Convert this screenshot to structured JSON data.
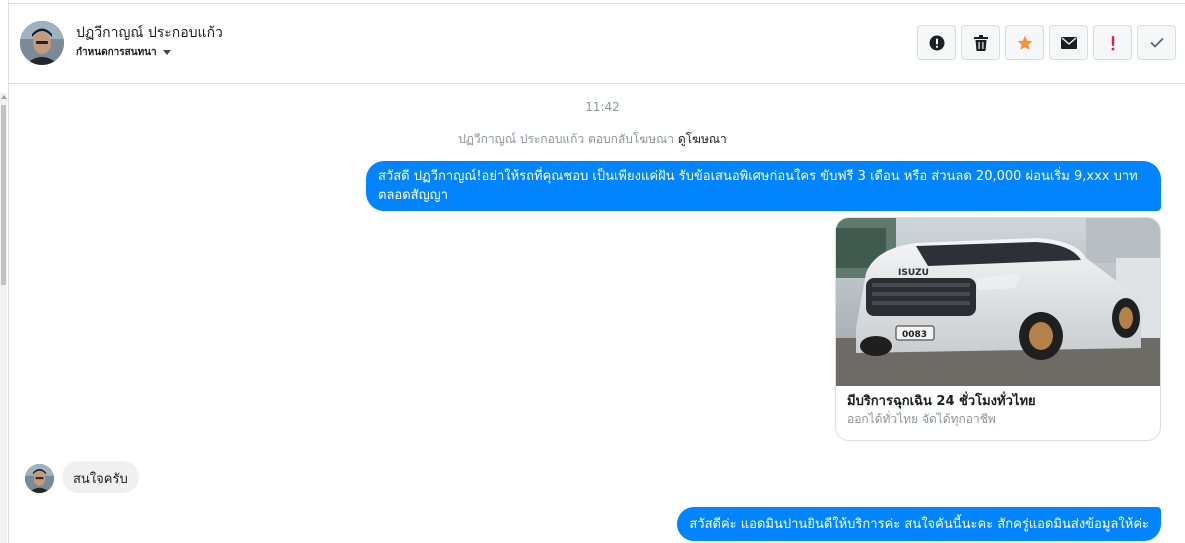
{
  "header": {
    "contact_name": "ปฏวีกาญณ์ ประกอบแก้ว",
    "label_button": "กำหนดการสนทนา",
    "actions": [
      {
        "name": "mark-spam-button",
        "icon": "alert-circle-icon",
        "color": "#1c1e21"
      },
      {
        "name": "delete-button",
        "icon": "trash-icon",
        "color": "#1c1e21"
      },
      {
        "name": "star-button",
        "icon": "star-icon",
        "color": "#f7923b"
      },
      {
        "name": "mark-unread-button",
        "icon": "envelope-icon",
        "color": "#1c1e21"
      },
      {
        "name": "important-button",
        "icon": "exclamation-icon",
        "color": "#e41e3f"
      },
      {
        "name": "mark-done-button",
        "icon": "checkmark-icon",
        "color": "#606770"
      }
    ]
  },
  "conversation": {
    "timestamp": "11:42",
    "ad_reply_notice": "ปฏวีกาญณ์ ประกอบแก้ว ตอบกลับโฆษณา",
    "ad_reply_link": "ดูโฆษณา",
    "messages": [
      {
        "direction": "outgoing",
        "text": "สวัสดี ปฏวีกาญณ์!อย่าให้รถที่คุณชอบ เป็นเพียงแค่ฝัน รับข้อเสนอพิเศษก่อนใคร ขับฟรี 3 เดือน หรือ ส่วนลด 20,000 ผ่อนเริ่ม 9,xxx บาท ตลอดสัญญา"
      },
      {
        "direction": "outgoing",
        "type": "ad-card",
        "image": "isuzu-pickup-truck-photo",
        "title": "มีบริการฉุกเฉิน 24 ชั่วโมงทั่วไทย",
        "subtitle": "ออกได้ทั่วไทย จัดได้ทุกอาชีพ"
      },
      {
        "direction": "incoming",
        "text": "สนใจครับ"
      },
      {
        "direction": "outgoing",
        "text": "สวัสดีค่ะ แอดมินปานยินดีให้บริการค่ะ สนใจคันนี้นะคะ สักครู่แอดมินส่งข้อมูลให้ค่ะ"
      }
    ]
  },
  "colors": {
    "outgoing_bubble": "#0084ff",
    "incoming_bubble": "#f1f0f0",
    "muted_text": "#90949c"
  }
}
